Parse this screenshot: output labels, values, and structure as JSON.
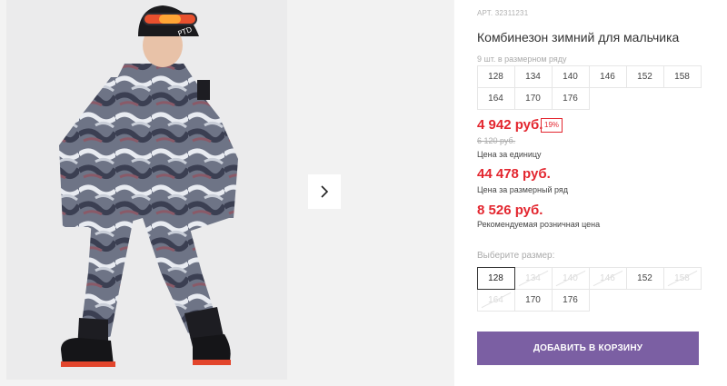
{
  "gallery": {
    "next_icon": "chevron-right-icon",
    "photo_alt": "boy-in-winter-jumpsuit"
  },
  "product": {
    "sku": "АРТ. 32311231",
    "title": "Комбинезон зимний для мальчика",
    "pack_note": "9 шт. в размерном ряду",
    "sizes_in_pack": [
      "128",
      "134",
      "140",
      "146",
      "152",
      "158",
      "164",
      "170",
      "176"
    ]
  },
  "pricing": {
    "unit_price": "4 942 руб.",
    "discount_badge": "19%",
    "old_price": "6 120 руб.",
    "unit_label": "Цена за единицу",
    "pack_price": "44 478 руб.",
    "pack_label": "Цена за размерный ряд",
    "retail_price": "8 526 руб.",
    "retail_label": "Рекомендуемая розничная цена"
  },
  "size_select": {
    "label": "Выберите размер:",
    "options": [
      {
        "value": "128",
        "available": true,
        "selected": true
      },
      {
        "value": "134",
        "available": false,
        "selected": false
      },
      {
        "value": "140",
        "available": false,
        "selected": false
      },
      {
        "value": "146",
        "available": false,
        "selected": false
      },
      {
        "value": "152",
        "available": true,
        "selected": false
      },
      {
        "value": "158",
        "available": false,
        "selected": false
      },
      {
        "value": "164",
        "available": false,
        "selected": false
      },
      {
        "value": "170",
        "available": true,
        "selected": false
      },
      {
        "value": "176",
        "available": true,
        "selected": false
      }
    ]
  },
  "cart": {
    "button_label": "ДОБАВИТЬ В КОРЗИНУ"
  },
  "colors": {
    "accent_red": "#e3262f",
    "button_purple": "#7b5fa3"
  }
}
